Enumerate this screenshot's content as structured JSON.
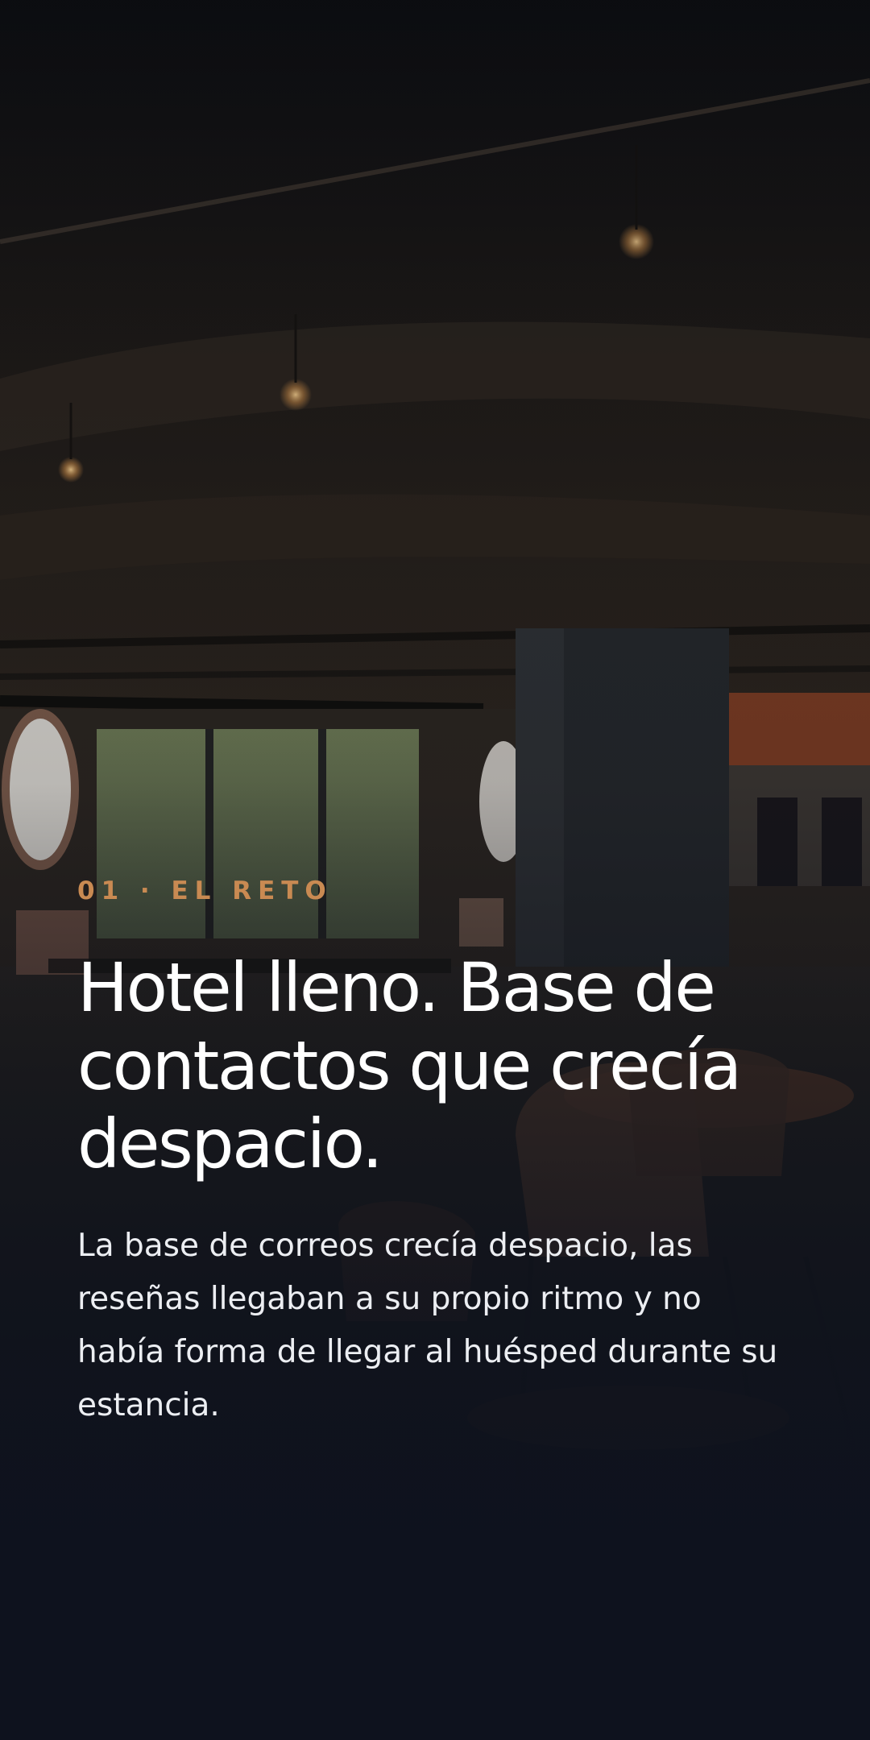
{
  "section": {
    "eyebrow": "01 · EL RETO",
    "headline": "Hotel lleno. Base de contactos que crecía despacio.",
    "body": "La base de correos crecía despacio, las reseñas llegaban a su propio ritmo y no había forma de llegar al huésped durante su estancia."
  },
  "background": {
    "subject": "dark restaurant interior with exposed ceiling and hanging bulbs"
  },
  "colors": {
    "accent": "#c98a52",
    "text": "#ffffff",
    "background": "#0f1218"
  }
}
